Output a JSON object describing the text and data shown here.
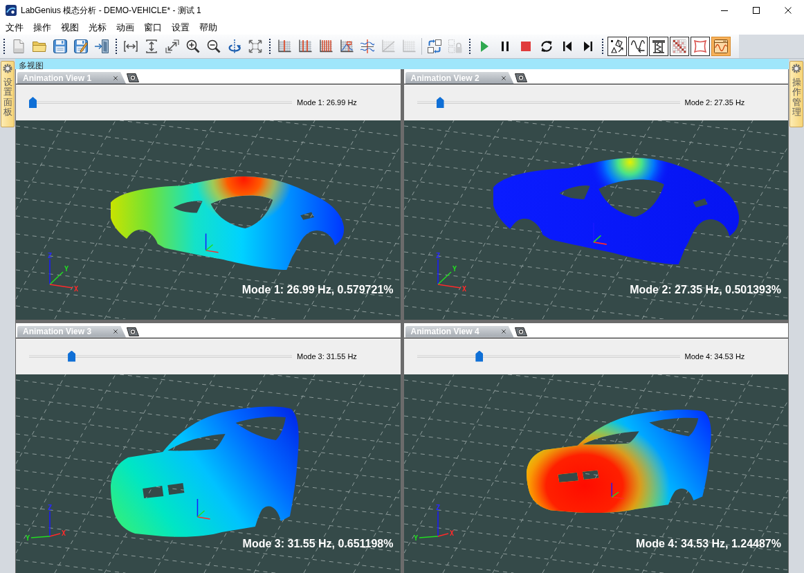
{
  "window": {
    "title": "LabGenius 模态分析 - DEMO-VEHICLE* - 测试 1"
  },
  "menu": [
    "文件",
    "操作",
    "视图",
    "光标",
    "动画",
    "窗口",
    "设置",
    "帮助"
  ],
  "toolbar": {
    "groups": [
      {
        "kind": "plain",
        "joined": false,
        "buttons": [
          {
            "kind": "new"
          },
          {
            "kind": "open"
          },
          {
            "kind": "save"
          },
          {
            "kind": "save-edit"
          },
          {
            "kind": "import"
          }
        ]
      },
      {
        "kind": "plain",
        "joined": false,
        "buttons": [
          {
            "kind": "fit-x"
          },
          {
            "kind": "fit-y"
          },
          {
            "kind": "fit-xy"
          },
          {
            "kind": "zoom-in"
          },
          {
            "kind": "zoom-out"
          },
          {
            "kind": "rotate"
          },
          {
            "kind": "fit-all"
          }
        ]
      },
      {
        "kind": "plain",
        "joined": false,
        "buttons": [
          {
            "kind": "grid-line",
            "disabled": false
          },
          {
            "kind": "grid-two",
            "disabled": false
          },
          {
            "kind": "grid-multi",
            "disabled": false
          },
          {
            "kind": "grid-box",
            "disabled": false
          },
          {
            "kind": "grid-cross",
            "disabled": false
          },
          {
            "kind": "grid-diag",
            "disabled": true
          },
          {
            "kind": "grid-plain",
            "disabled": true
          }
        ]
      },
      {
        "kind": "plain",
        "joined": true,
        "buttons": [
          {
            "kind": "swap",
            "disabled": false
          },
          {
            "kind": "lock",
            "disabled": true
          }
        ]
      },
      {
        "kind": "plain",
        "joined": false,
        "buttons": [
          {
            "kind": "play"
          },
          {
            "kind": "pause"
          },
          {
            "kind": "stop"
          },
          {
            "kind": "loop"
          },
          {
            "kind": "previous"
          },
          {
            "kind": "next"
          }
        ]
      },
      {
        "kind": "framed",
        "joined": false,
        "buttons": [
          {
            "kind": "shapes",
            "selected": false
          },
          {
            "kind": "wave-arrow",
            "selected": false
          },
          {
            "kind": "structure",
            "selected": false
          },
          {
            "kind": "matrix",
            "selected": false
          },
          {
            "kind": "distort",
            "selected": false
          },
          {
            "kind": "wave-window",
            "selected": true
          }
        ]
      }
    ]
  },
  "panel": {
    "title": "多视图"
  },
  "sidebars": {
    "left": {
      "label": "设置面板"
    },
    "right": {
      "label": "操作管理"
    }
  },
  "views": [
    {
      "tab": "Animation View 1",
      "kind": "rear",
      "slider": {
        "level": 0,
        "label": "Mode 1: 26.99 Hz"
      },
      "axes": {
        "x": "X",
        "y": "Y",
        "z": "Z"
      },
      "overlay": "Mode 1: 26.99 Hz, 0.579721%"
    },
    {
      "tab": "Animation View 2",
      "kind": "rear",
      "slider": {
        "level": 0.076,
        "label": "Mode 2: 27.35 Hz"
      },
      "axes": {
        "x": "X",
        "y": "Y",
        "z": "Z"
      },
      "overlay": "Mode 2: 27.35 Hz, 0.501393%"
    },
    {
      "tab": "Animation View 3",
      "kind": "front",
      "slider": {
        "level": 0.152,
        "label": "Mode 3: 31.55 Hz"
      },
      "axes": {
        "x": "X",
        "y": "Y",
        "z": "Z"
      },
      "overlay": "Mode 3: 31.55 Hz, 0.651198%"
    },
    {
      "tab": "Animation View 4",
      "kind": "front",
      "slider": {
        "level": 0.23,
        "label": "Mode 4: 34.53 Hz"
      },
      "axes": {
        "x": "X",
        "y": "Y",
        "z": "Z"
      },
      "overlay": "Mode 4: 34.53 Hz, 1.24487%"
    }
  ]
}
